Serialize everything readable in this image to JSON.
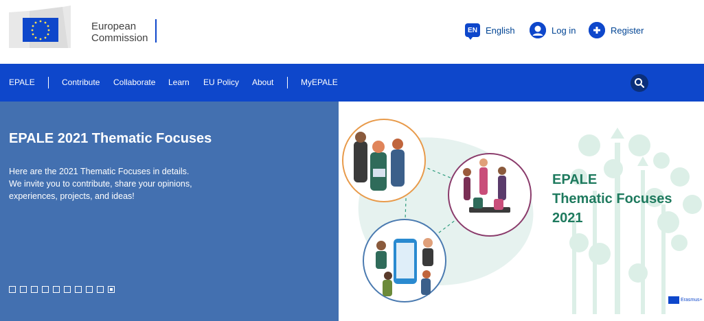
{
  "header": {
    "logo_line1": "European",
    "logo_line2": "Commission",
    "language_code": "EN",
    "language_label": "English",
    "login_label": "Log in",
    "register_label": "Register"
  },
  "nav": {
    "items": [
      "EPALE",
      "Contribute",
      "Collaborate",
      "Learn",
      "EU Policy",
      "About",
      "MyEPALE"
    ]
  },
  "hero": {
    "title": "EPALE 2021 Thematic Focuses",
    "description_lines": [
      "Here are the 2021 Thematic Focuses in details.",
      "We invite you to contribute, share your opinions,",
      "experiences, projects, and ideas!"
    ],
    "slide_count": 10,
    "active_slide": 10,
    "image_title_lines": [
      "EPALE",
      "Thematic Focuses",
      "2021"
    ],
    "badge_label": "Erasmus+"
  },
  "colors": {
    "brand_blue": "#0e47cb",
    "hero_panel": "#4370b0",
    "focus_green": "#1e7a5e"
  },
  "icons": {
    "language": "speech-bubble-icon",
    "login": "user-icon",
    "register": "plus-icon",
    "search": "search-icon"
  }
}
